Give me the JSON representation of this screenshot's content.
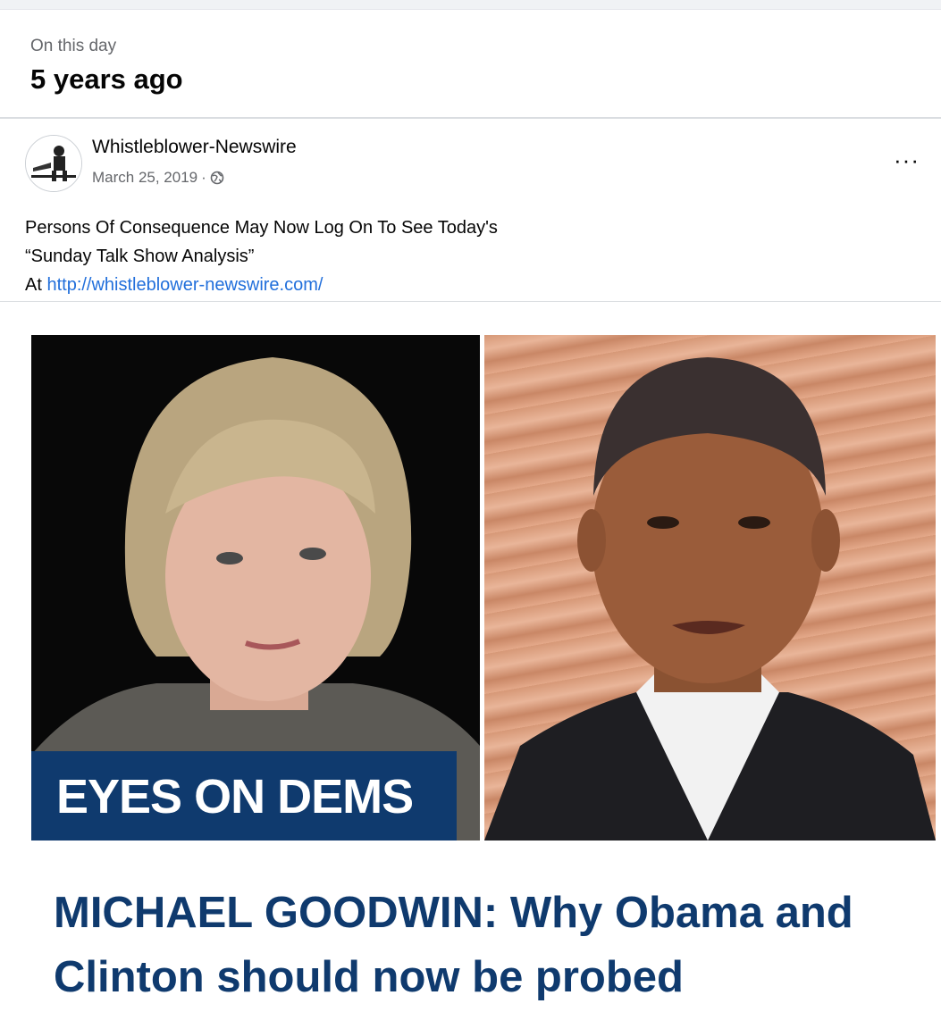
{
  "memory": {
    "kicker": "On this day",
    "title": "5 years ago"
  },
  "post": {
    "page_name": "Whistleblower-Newswire",
    "date": "March 25, 2019",
    "separator": "·",
    "privacy_icon": "globe-icon",
    "more_label": "···",
    "text_line1": "Persons Of Consequence May Now Log On To See Today's",
    "text_line2": "“Sunday Talk Show Analysis”",
    "text_line3_prefix": "At ",
    "link": "http://whistleblower-newswire.com/"
  },
  "image": {
    "caption": "EYES ON DEMS",
    "headline": "MICHAEL GOODWIN: Why Obama and Clinton should now be probed"
  },
  "colors": {
    "headline": "#0f3a6e",
    "link": "#216fdb",
    "caption_bg": "#0f3a6e"
  }
}
